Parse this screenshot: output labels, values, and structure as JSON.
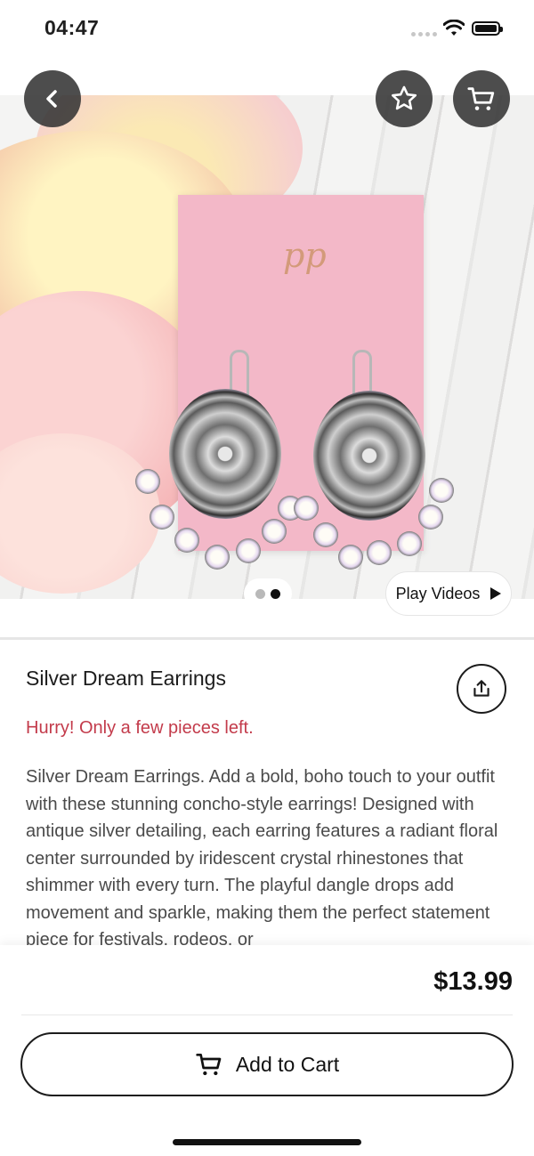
{
  "status_bar": {
    "time": "04:47"
  },
  "product": {
    "name": "Silver Dream Earrings",
    "urgency": "Hurry! Only a few pieces left.",
    "description": "Silver Dream Earrings. Add a bold, boho touch to your outfit with these stunning concho-style earrings! Designed with antique silver detailing, each earring features a radiant floral center surrounded by iridescent crystal rhinestones that shimmer with every turn. The playful dangle drops add movement and sparkle, making them the perfect statement piece for festivals, rodeos, or",
    "price": "$13.99",
    "image_logo_text": "pp"
  },
  "gallery": {
    "total_images": 2,
    "active_index": 1,
    "play_videos_label": "Play Videos"
  },
  "actions": {
    "add_to_cart_label": "Add to Cart"
  },
  "icons": {
    "back": "chevron-left-icon",
    "favorite": "star-icon",
    "cart": "cart-icon",
    "share": "share-icon",
    "play": "play-icon"
  },
  "colors": {
    "urgency": "#c33b4b",
    "button_overlay": "#343434",
    "text": "#1c1c1c"
  }
}
